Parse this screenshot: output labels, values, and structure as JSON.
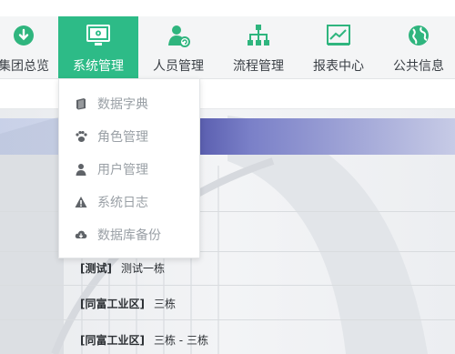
{
  "nav": {
    "items": [
      {
        "label": "集团总览",
        "icon": "cloud-download-icon"
      },
      {
        "label": "系统管理",
        "icon": "monitor-settings-icon",
        "active": true
      },
      {
        "label": "人员管理",
        "icon": "user-refresh-icon"
      },
      {
        "label": "流程管理",
        "icon": "org-chart-icon"
      },
      {
        "label": "报表中心",
        "icon": "line-chart-icon"
      },
      {
        "label": "公共信息",
        "icon": "globe-icon"
      }
    ]
  },
  "dropdown": {
    "items": [
      {
        "label": "数据字典",
        "icon": "book-icon"
      },
      {
        "label": "角色管理",
        "icon": "paw-icon"
      },
      {
        "label": "用户管理",
        "icon": "user-icon"
      },
      {
        "label": "系统日志",
        "icon": "warning-icon"
      },
      {
        "label": "数据库备份",
        "icon": "cloud-download-icon"
      }
    ]
  },
  "list": {
    "rows": [
      {
        "tag": "[测试]",
        "text": "测试一栋"
      },
      {
        "tag": "[同富工业区]",
        "text": "三栋"
      },
      {
        "tag": "[同富工业区]",
        "text": "三栋 - 三栋"
      }
    ]
  },
  "colors": {
    "accent": "#2dbb87",
    "icon_green": "#2fb57e",
    "menu_text": "#9aa0a6",
    "band_blue": "#5b5fb0"
  }
}
